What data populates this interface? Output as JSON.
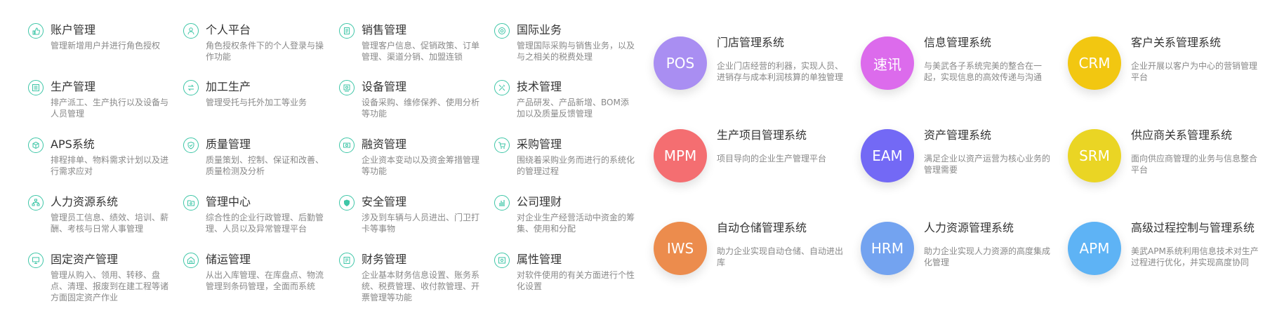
{
  "features": [
    {
      "title": "账户管理",
      "desc": "管理新增用户并进行角色授权",
      "icon": "thumbs-up-icon"
    },
    {
      "title": "个人平台",
      "desc": "角色授权条件下的个人登录与操作功能",
      "icon": "user-icon"
    },
    {
      "title": "销售管理",
      "desc": "管理客户信息、促销政策、订单管理、渠道分销、加盟连锁",
      "icon": "document-icon"
    },
    {
      "title": "国际业务",
      "desc": "管理国际采购与销售业务，以及与之相关的税费处理",
      "icon": "globe-icon"
    },
    {
      "title": "生产管理",
      "desc": "排产派工、生产执行以及设备与人员管理",
      "icon": "list-icon"
    },
    {
      "title": "加工生产",
      "desc": "管理受托与托外加工等业务",
      "icon": "exchange-icon"
    },
    {
      "title": "设备管理",
      "desc": "设备采购、维修保养、使用分析等功能",
      "icon": "device-icon"
    },
    {
      "title": "技术管理",
      "desc": "产品研发、产品新增、BOM添加以及质量反馈管理",
      "icon": "tools-icon"
    },
    {
      "title": "APS系统",
      "desc": "排程排单、物料需求计划以及进行需求应对",
      "icon": "cube-icon"
    },
    {
      "title": "质量管理",
      "desc": "质量策划、控制、保证和改善、质量检测及分析",
      "icon": "shield-check-icon"
    },
    {
      "title": "融资管理",
      "desc": "企业资本变动以及资金筹措管理等功能",
      "icon": "money-icon"
    },
    {
      "title": "采购管理",
      "desc": "围绕着采购业务而进行的系统化的管理过程",
      "icon": "cart-icon"
    },
    {
      "title": "人力资源系统",
      "desc": "管理员工信息、绩效、培训、薪酬、考核与日常人事管理",
      "icon": "org-chart-icon"
    },
    {
      "title": "管理中心",
      "desc": "综合性的企业行政管理、后勤管理、人员以及异常管理平台",
      "icon": "folder-settings-icon"
    },
    {
      "title": "安全管理",
      "desc": "涉及到车辆与人员进出、门卫打卡等事物",
      "icon": "shield-icon"
    },
    {
      "title": "公司理财",
      "desc": "对企业生产经营活动中资金的筹集、使用和分配",
      "icon": "bar-chart-icon"
    },
    {
      "title": "固定资产管理",
      "desc": "管理从购入、领用、转移、盘点、清理、报废到在建工程等诸方面固定资产作业",
      "icon": "monitor-icon"
    },
    {
      "title": "储运管理",
      "desc": "从出入库管理、在库盘点、物流管理到条码管理，全面而系统",
      "icon": "warehouse-icon"
    },
    {
      "title": "财务管理",
      "desc": "企业基本财务信息设置、账务系统、税费管理、收付款管理、开票管理等功能",
      "icon": "finance-icon"
    },
    {
      "title": "属性管理",
      "desc": "对软件使用的有关方面进行个性化设置",
      "icon": "settings-window-icon"
    }
  ],
  "systems": [
    {
      "abbr": "POS",
      "title": "门店管理系统",
      "desc": "企业门店经营的利器，实现人员、进销存与成本利润核算的单独管理",
      "color": "#a98ef2"
    },
    {
      "abbr": "速讯",
      "title": "信息管理系统",
      "desc": "与美武各子系统完美的整合在一起，实现信息的高效传递与沟通",
      "color": "#dc6bec"
    },
    {
      "abbr": "CRM",
      "title": "客户关系管理系统",
      "desc": "企业开展以客户为中心的营销管理平台",
      "color": "#f2c711"
    },
    {
      "abbr": "MPM",
      "title": "生产项目管理系统",
      "desc": "项目导向的企业生产管理平台",
      "color": "#f46e71"
    },
    {
      "abbr": "EAM",
      "title": "资产管理系统",
      "desc": "满足企业以资产运营为核心业务的管理需要",
      "color": "#7369f5"
    },
    {
      "abbr": "SRM",
      "title": "供应商关系管理系统",
      "desc": "面向供应商管理的业务与信息整合平台",
      "color": "#ead524"
    },
    {
      "abbr": "IWS",
      "title": "自动仓储管理系统",
      "desc": "助力企业实现自动仓储、自动进出库",
      "color": "#ec8c4d"
    },
    {
      "abbr": "HRM",
      "title": "人力资源管理系统",
      "desc": "助力企业实现人力资源的高度集成化管理",
      "color": "#73a3f0"
    },
    {
      "abbr": "APM",
      "title": "高级过程控制与管理系统",
      "desc": "美武APM系统利用信息技术对生产过程进行优化，并实现高度协同",
      "color": "#5eb3f5"
    }
  ]
}
